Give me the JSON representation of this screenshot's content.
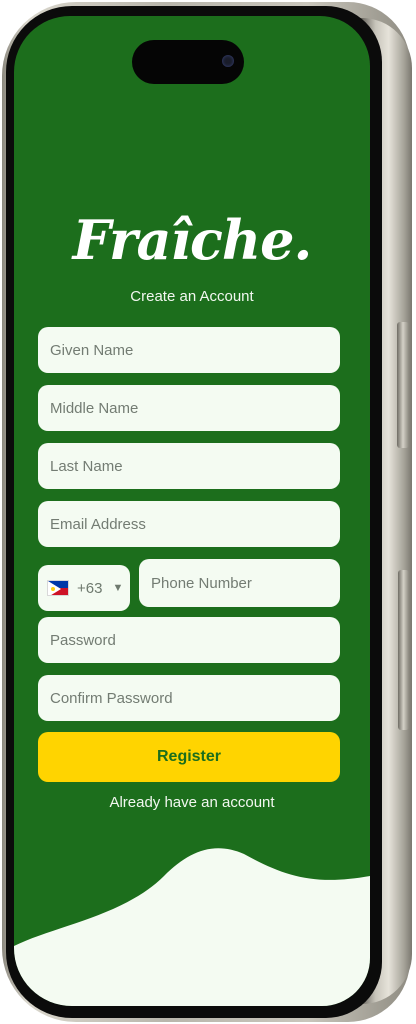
{
  "app": {
    "logo_text": "Fraîche.",
    "subtitle": "Create an Account"
  },
  "form": {
    "given_name_placeholder": "Given Name",
    "middle_name_placeholder": "Middle Name",
    "last_name_placeholder": "Last Name",
    "email_placeholder": "Email Address",
    "country_code": "+63",
    "country_flag_icon": "philippines-flag-icon",
    "phone_placeholder": "Phone Number",
    "password_placeholder": "Password",
    "confirm_password_placeholder": "Confirm Password",
    "register_label": "Register",
    "login_link": "Already have an account"
  },
  "colors": {
    "brand_green": "#1c6e1c",
    "accent_yellow": "#ffd400",
    "field_bg": "#f4fbf2"
  }
}
